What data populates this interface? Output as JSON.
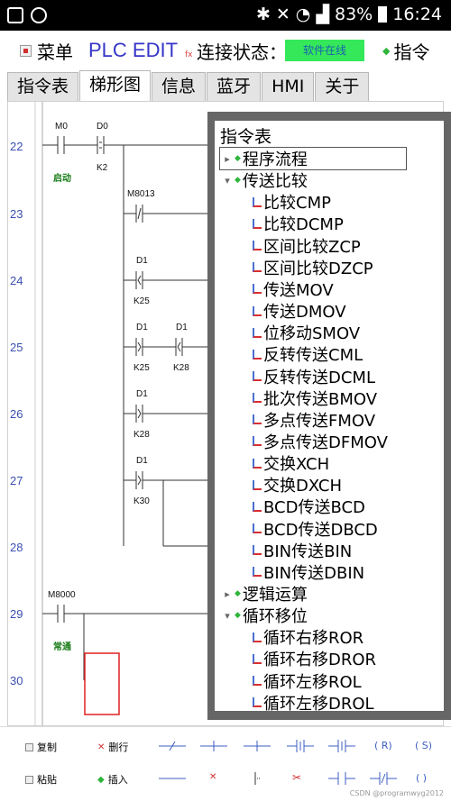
{
  "status_bar": {
    "battery": "83%",
    "time": "16:24"
  },
  "top_bar": {
    "menu_label": "菜单",
    "app_title": "PLC EDIT",
    "app_title_suffix": "fx",
    "connection_label": "连接状态：",
    "connection_badge": "软件在线",
    "command_label": "指令"
  },
  "tabs": [
    {
      "label": "指令表",
      "active": false
    },
    {
      "label": "梯形图",
      "active": true
    },
    {
      "label": "信息",
      "active": false
    },
    {
      "label": "蓝牙",
      "active": false
    },
    {
      "label": "HMI",
      "active": false
    },
    {
      "label": "关于",
      "active": false
    }
  ],
  "ladder": {
    "row_numbers": [
      "22",
      "23",
      "24",
      "25",
      "26",
      "27",
      "28",
      "29",
      "30"
    ],
    "labels": {
      "m0": "M0",
      "d0": "D0",
      "k2": "K2",
      "qidong": "启动",
      "m8013": "M8013",
      "d1_a": "D1",
      "k25_a": "K25",
      "d1_b": "D1",
      "k25_b": "K25",
      "d1_c": "D1",
      "k28_a": "K28",
      "d1_d": "D1",
      "k28_b": "K28",
      "d1_e": "D1",
      "k30": "K30",
      "m8000": "M8000",
      "changtong": "常通"
    }
  },
  "instruction_panel": {
    "title": "指令表",
    "items": [
      {
        "label": "程序流程",
        "type": "group",
        "expanded": false,
        "selected": true
      },
      {
        "label": "传送比较",
        "type": "group",
        "expanded": true
      },
      {
        "label": "比较CMP",
        "type": "leaf"
      },
      {
        "label": "比较DCMP",
        "type": "leaf"
      },
      {
        "label": "区间比较ZCP",
        "type": "leaf"
      },
      {
        "label": "区间比较DZCP",
        "type": "leaf"
      },
      {
        "label": "传送MOV",
        "type": "leaf"
      },
      {
        "label": "传送DMOV",
        "type": "leaf"
      },
      {
        "label": "位移动SMOV",
        "type": "leaf"
      },
      {
        "label": "反转传送CML",
        "type": "leaf"
      },
      {
        "label": "反转传送DCML",
        "type": "leaf"
      },
      {
        "label": "批次传送BMOV",
        "type": "leaf"
      },
      {
        "label": "多点传送FMOV",
        "type": "leaf"
      },
      {
        "label": "多点传送DFMOV",
        "type": "leaf"
      },
      {
        "label": "交换XCH",
        "type": "leaf"
      },
      {
        "label": "交换DXCH",
        "type": "leaf"
      },
      {
        "label": "BCD传送BCD",
        "type": "leaf"
      },
      {
        "label": "BCD传送DBCD",
        "type": "leaf"
      },
      {
        "label": "BIN传送BIN",
        "type": "leaf"
      },
      {
        "label": "BIN传送DBIN",
        "type": "leaf"
      },
      {
        "label": "逻辑运算",
        "type": "group",
        "expanded": false
      },
      {
        "label": "循环移位",
        "type": "group",
        "expanded": true
      },
      {
        "label": "循环右移ROR",
        "type": "leaf"
      },
      {
        "label": "循环右移DROR",
        "type": "leaf"
      },
      {
        "label": "循环左移ROL",
        "type": "leaf"
      },
      {
        "label": "循环左移DROL",
        "type": "leaf"
      }
    ]
  },
  "bottom_toolbar": {
    "copy_label": "复制",
    "delete_row_label": "删行",
    "paste_label": "粘贴",
    "insert_label": "插入",
    "coil_r": "( R)",
    "coil_s": "( S)",
    "coil_plain": "(  )"
  },
  "watermark": "CSDN @programwyg2012"
}
